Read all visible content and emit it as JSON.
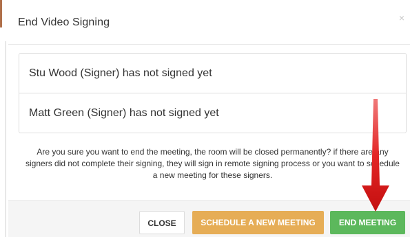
{
  "modal": {
    "title": "End Video Signing",
    "close_icon": "×"
  },
  "signers": [
    {
      "text": "Stu Wood (Signer) has not signed yet"
    },
    {
      "text": "Matt Green (Signer) has not signed yet"
    }
  ],
  "message": "Are you sure you want to end the meeting, the room will be closed permanently? if there are any signers did not complete their signing, they will sign in remote signing process or you want to schedule a new meeting for these signers.",
  "buttons": {
    "close_label": "CLOSE",
    "schedule_label": "SCHEDULE A NEW MEETING",
    "end_label": "END MEETING"
  },
  "annotation": {
    "arrow_icon": "red-down-arrow-icon",
    "color": "#e11b1b"
  },
  "colors": {
    "schedule": "#e6ad56",
    "end": "#5cb85c"
  }
}
